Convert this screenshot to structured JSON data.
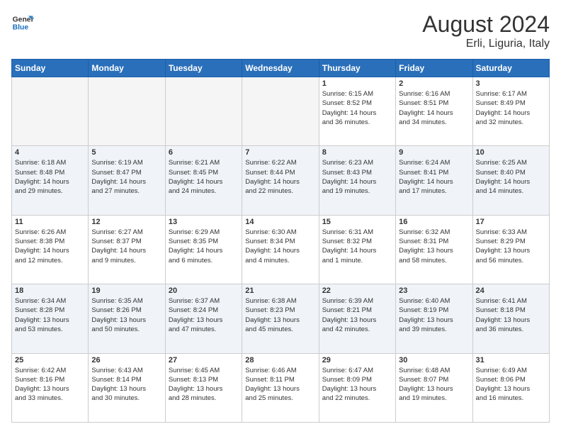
{
  "logo": {
    "line1": "General",
    "line2": "Blue"
  },
  "title": "August 2024",
  "location": "Erli, Liguria, Italy",
  "days_of_week": [
    "Sunday",
    "Monday",
    "Tuesday",
    "Wednesday",
    "Thursday",
    "Friday",
    "Saturday"
  ],
  "weeks": [
    [
      {
        "day": "",
        "info": ""
      },
      {
        "day": "",
        "info": ""
      },
      {
        "day": "",
        "info": ""
      },
      {
        "day": "",
        "info": ""
      },
      {
        "day": "1",
        "info": "Sunrise: 6:15 AM\nSunset: 8:52 PM\nDaylight: 14 hours\nand 36 minutes."
      },
      {
        "day": "2",
        "info": "Sunrise: 6:16 AM\nSunset: 8:51 PM\nDaylight: 14 hours\nand 34 minutes."
      },
      {
        "day": "3",
        "info": "Sunrise: 6:17 AM\nSunset: 8:49 PM\nDaylight: 14 hours\nand 32 minutes."
      }
    ],
    [
      {
        "day": "4",
        "info": "Sunrise: 6:18 AM\nSunset: 8:48 PM\nDaylight: 14 hours\nand 29 minutes."
      },
      {
        "day": "5",
        "info": "Sunrise: 6:19 AM\nSunset: 8:47 PM\nDaylight: 14 hours\nand 27 minutes."
      },
      {
        "day": "6",
        "info": "Sunrise: 6:21 AM\nSunset: 8:45 PM\nDaylight: 14 hours\nand 24 minutes."
      },
      {
        "day": "7",
        "info": "Sunrise: 6:22 AM\nSunset: 8:44 PM\nDaylight: 14 hours\nand 22 minutes."
      },
      {
        "day": "8",
        "info": "Sunrise: 6:23 AM\nSunset: 8:43 PM\nDaylight: 14 hours\nand 19 minutes."
      },
      {
        "day": "9",
        "info": "Sunrise: 6:24 AM\nSunset: 8:41 PM\nDaylight: 14 hours\nand 17 minutes."
      },
      {
        "day": "10",
        "info": "Sunrise: 6:25 AM\nSunset: 8:40 PM\nDaylight: 14 hours\nand 14 minutes."
      }
    ],
    [
      {
        "day": "11",
        "info": "Sunrise: 6:26 AM\nSunset: 8:38 PM\nDaylight: 14 hours\nand 12 minutes."
      },
      {
        "day": "12",
        "info": "Sunrise: 6:27 AM\nSunset: 8:37 PM\nDaylight: 14 hours\nand 9 minutes."
      },
      {
        "day": "13",
        "info": "Sunrise: 6:29 AM\nSunset: 8:35 PM\nDaylight: 14 hours\nand 6 minutes."
      },
      {
        "day": "14",
        "info": "Sunrise: 6:30 AM\nSunset: 8:34 PM\nDaylight: 14 hours\nand 4 minutes."
      },
      {
        "day": "15",
        "info": "Sunrise: 6:31 AM\nSunset: 8:32 PM\nDaylight: 14 hours\nand 1 minute."
      },
      {
        "day": "16",
        "info": "Sunrise: 6:32 AM\nSunset: 8:31 PM\nDaylight: 13 hours\nand 58 minutes."
      },
      {
        "day": "17",
        "info": "Sunrise: 6:33 AM\nSunset: 8:29 PM\nDaylight: 13 hours\nand 56 minutes."
      }
    ],
    [
      {
        "day": "18",
        "info": "Sunrise: 6:34 AM\nSunset: 8:28 PM\nDaylight: 13 hours\nand 53 minutes."
      },
      {
        "day": "19",
        "info": "Sunrise: 6:35 AM\nSunset: 8:26 PM\nDaylight: 13 hours\nand 50 minutes."
      },
      {
        "day": "20",
        "info": "Sunrise: 6:37 AM\nSunset: 8:24 PM\nDaylight: 13 hours\nand 47 minutes."
      },
      {
        "day": "21",
        "info": "Sunrise: 6:38 AM\nSunset: 8:23 PM\nDaylight: 13 hours\nand 45 minutes."
      },
      {
        "day": "22",
        "info": "Sunrise: 6:39 AM\nSunset: 8:21 PM\nDaylight: 13 hours\nand 42 minutes."
      },
      {
        "day": "23",
        "info": "Sunrise: 6:40 AM\nSunset: 8:19 PM\nDaylight: 13 hours\nand 39 minutes."
      },
      {
        "day": "24",
        "info": "Sunrise: 6:41 AM\nSunset: 8:18 PM\nDaylight: 13 hours\nand 36 minutes."
      }
    ],
    [
      {
        "day": "25",
        "info": "Sunrise: 6:42 AM\nSunset: 8:16 PM\nDaylight: 13 hours\nand 33 minutes."
      },
      {
        "day": "26",
        "info": "Sunrise: 6:43 AM\nSunset: 8:14 PM\nDaylight: 13 hours\nand 30 minutes."
      },
      {
        "day": "27",
        "info": "Sunrise: 6:45 AM\nSunset: 8:13 PM\nDaylight: 13 hours\nand 28 minutes."
      },
      {
        "day": "28",
        "info": "Sunrise: 6:46 AM\nSunset: 8:11 PM\nDaylight: 13 hours\nand 25 minutes."
      },
      {
        "day": "29",
        "info": "Sunrise: 6:47 AM\nSunset: 8:09 PM\nDaylight: 13 hours\nand 22 minutes."
      },
      {
        "day": "30",
        "info": "Sunrise: 6:48 AM\nSunset: 8:07 PM\nDaylight: 13 hours\nand 19 minutes."
      },
      {
        "day": "31",
        "info": "Sunrise: 6:49 AM\nSunset: 8:06 PM\nDaylight: 13 hours\nand 16 minutes."
      }
    ]
  ]
}
